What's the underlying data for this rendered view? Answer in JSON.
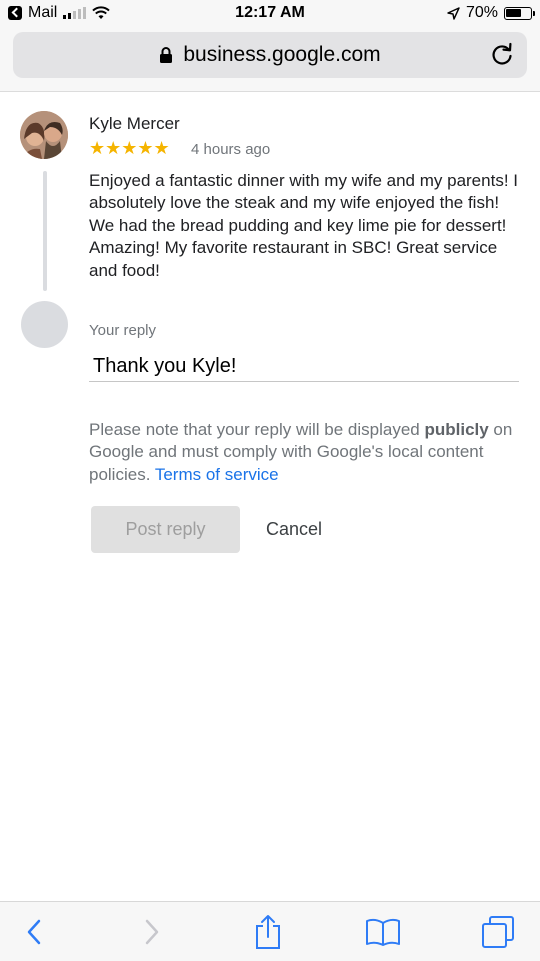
{
  "status_bar": {
    "back_app": "Mail",
    "time": "12:17 AM",
    "battery_text": "70%",
    "battery_level": 0.7
  },
  "browser": {
    "url": "business.google.com"
  },
  "review": {
    "reviewer_name": "Kyle Mercer",
    "rating": 5,
    "stars": "★★★★★",
    "time_ago": "4 hours ago",
    "text": "Enjoyed a fantastic dinner with my wife and my parents! I absolutely love the steak and my wife enjoyed the fish! We had the bread pudding and key lime pie for dessert! Amazing! My favorite restaurant in SBC! Great service and food!"
  },
  "reply": {
    "label": "Your reply",
    "value": "Thank you Kyle!",
    "notice_before": "Please note that your reply will be displayed ",
    "notice_bold": "publicly",
    "notice_after": " on Google and must comply with Google's local content policies. ",
    "terms_link": "Terms of service",
    "post_label": "Post reply",
    "cancel_label": "Cancel"
  },
  "colors": {
    "star": "#f5b400",
    "link": "#1a73e8",
    "ios_blue": "#2f7cf6"
  },
  "toolbar": {
    "icons": [
      "back-icon",
      "forward-icon",
      "share-icon",
      "bookmarks-icon",
      "tabs-icon"
    ]
  }
}
